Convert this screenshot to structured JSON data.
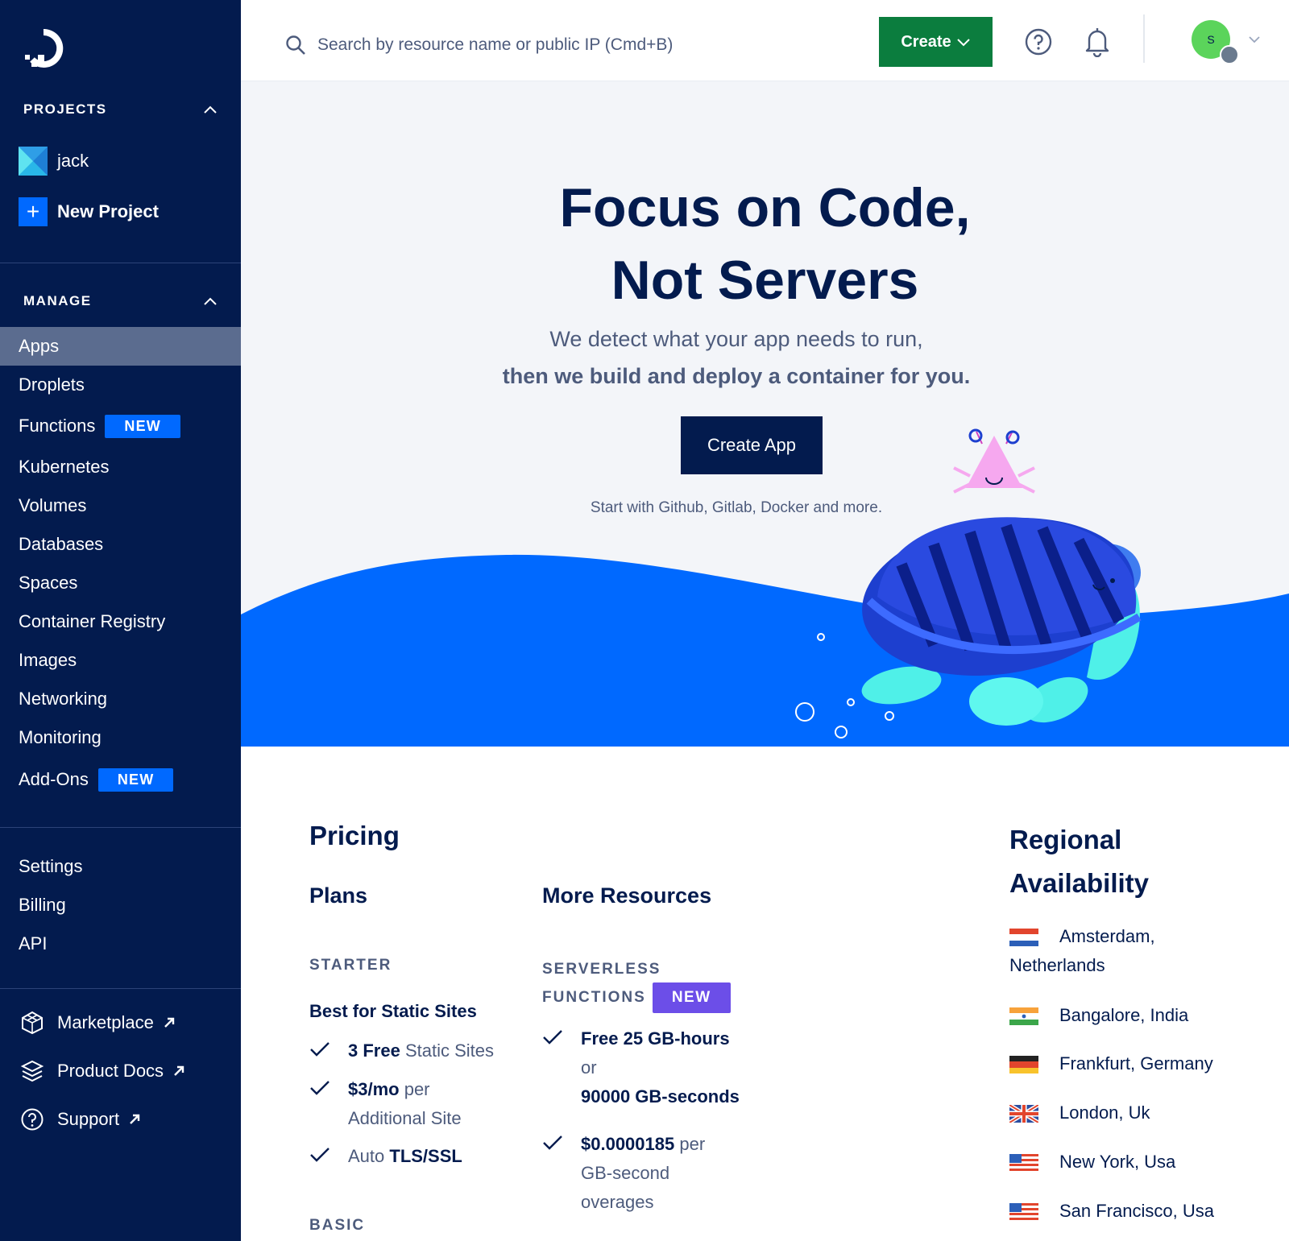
{
  "sidebar": {
    "projects_header": "PROJECTS",
    "projects": [
      {
        "label": "jack"
      },
      {
        "label": "New Project"
      }
    ],
    "manage_header": "MANAGE",
    "nav": [
      {
        "label": "Apps",
        "active": true
      },
      {
        "label": "Droplets"
      },
      {
        "label": "Functions",
        "badge": "NEW"
      },
      {
        "label": "Kubernetes"
      },
      {
        "label": "Volumes"
      },
      {
        "label": "Databases"
      },
      {
        "label": "Spaces"
      },
      {
        "label": "Container Registry"
      },
      {
        "label": "Images"
      },
      {
        "label": "Networking"
      },
      {
        "label": "Monitoring"
      },
      {
        "label": "Add-Ons",
        "badge": "NEW"
      }
    ],
    "account": [
      {
        "label": "Settings"
      },
      {
        "label": "Billing"
      },
      {
        "label": "API"
      }
    ],
    "external": [
      {
        "label": "Marketplace",
        "icon": "marketplace-icon"
      },
      {
        "label": "Product Docs",
        "icon": "docs-icon"
      },
      {
        "label": "Support",
        "icon": "support-icon"
      }
    ]
  },
  "topbar": {
    "search_placeholder": "Search by resource name or public IP (Cmd+B)",
    "create_label": "Create",
    "avatar_initial": "S"
  },
  "hero": {
    "title_line1": "Focus on Code,",
    "title_line2": "Not Servers",
    "sub1": "We detect what your app needs to run,",
    "sub2": "then we build and deploy a container for you.",
    "cta": "Create App",
    "start_with": "Start with Github, Gitlab, Docker and more."
  },
  "pricing": {
    "title": "Pricing",
    "plans_title": "Plans",
    "more_title": "More Resources",
    "starter": {
      "tier": "STARTER",
      "name": "Best for Static Sites",
      "items": [
        {
          "bold": "3 Free",
          "rest": " Static Sites"
        },
        {
          "bold": "$3/mo",
          "rest": " per",
          "line2": "Additional Site"
        },
        {
          "pre": "Auto ",
          "bold": "TLS/SSL"
        }
      ]
    },
    "basic_tier": "BASIC",
    "serverless": {
      "tier_line1": "SERVERLESS",
      "tier_line2": "FUNCTIONS",
      "badge": "NEW",
      "item1_bold": "Free 25 GB-hours",
      "item1_or": "or",
      "item1_bold2": "90000 GB-seconds",
      "item2_bold": "$0.0000185",
      "item2_rest": " per",
      "item2_line2": "GB-second",
      "item2_line3": "overages"
    }
  },
  "regions": {
    "title_line1": "Regional",
    "title_line2": "Availability",
    "list": [
      {
        "line1": "Amsterdam,",
        "line2": "Netherlands",
        "flag": "nl"
      },
      {
        "line1": "Bangalore, India",
        "flag": "in"
      },
      {
        "line1": "Frankfurt, Germany",
        "flag": "de"
      },
      {
        "line1": "London, Uk",
        "flag": "uk"
      },
      {
        "line1": "New York, Usa",
        "flag": "us"
      },
      {
        "line1": "San Francisco, Usa",
        "flag": "us"
      }
    ]
  },
  "colors": {
    "sidebar_bg": "#031b4e",
    "accent_blue": "#0069ff",
    "create_green": "#0b7d3e",
    "purple_badge": "#6c4ee8"
  }
}
